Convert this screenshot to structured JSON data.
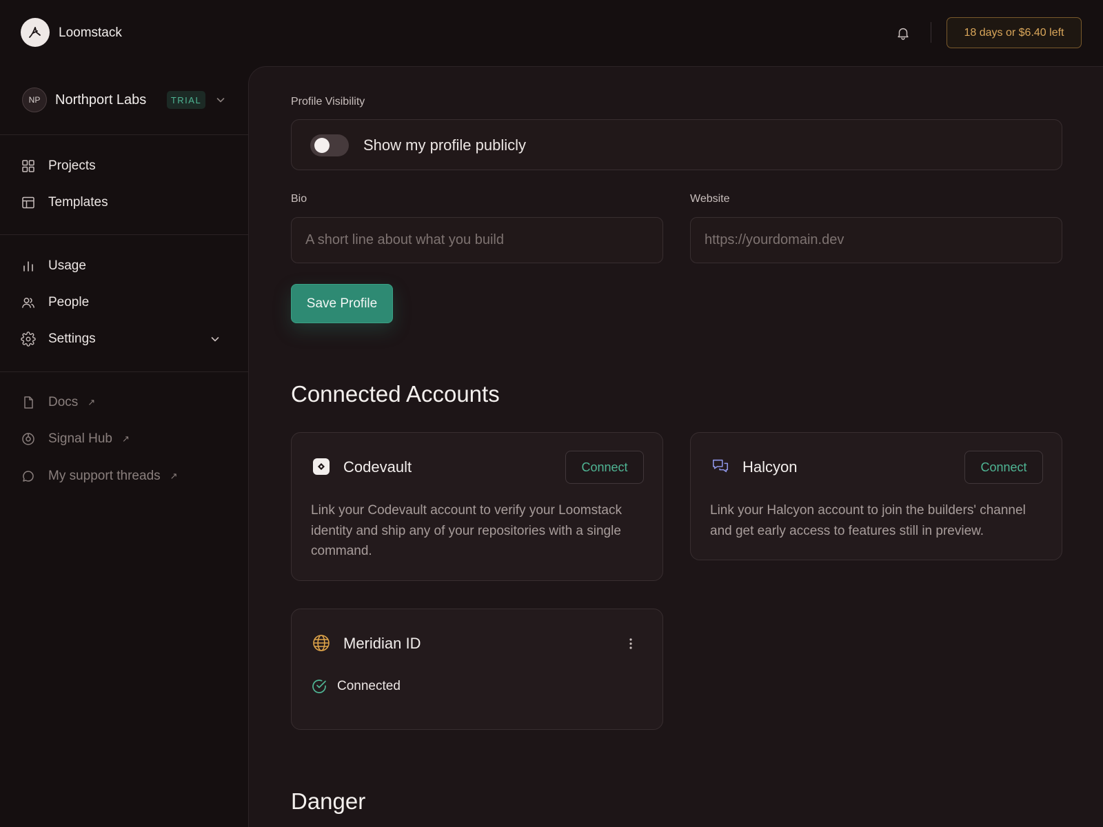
{
  "app": {
    "name": "Loomstack"
  },
  "topbar": {
    "trial_text": "18 days or $6.40 left"
  },
  "sidebar": {
    "org": {
      "initials": "NP",
      "name": "Northport Labs",
      "badge": "TRIAL"
    },
    "items": [
      {
        "label": "Projects",
        "icon": "grid-icon"
      },
      {
        "label": "Templates",
        "icon": "layout-icon"
      },
      {
        "label": "Usage",
        "icon": "bar-chart-icon"
      },
      {
        "label": "People",
        "icon": "users-icon"
      },
      {
        "label": "Settings",
        "icon": "gear-icon"
      },
      {
        "label": "Docs",
        "icon": "file-icon",
        "ext": "↗"
      },
      {
        "label": "Signal Hub",
        "icon": "signal-icon",
        "ext": "↗"
      },
      {
        "label": "My support threads",
        "icon": "chat-icon",
        "ext": "↗"
      }
    ]
  },
  "profile": {
    "visibility_label": "Profile Visibility",
    "visibility_toggle_text": "Show my profile publicly",
    "visibility_on": false,
    "bio_label": "Bio",
    "bio_placeholder": "A short line about what you build",
    "website_label": "Website",
    "website_placeholder": "https://yourdomain.dev",
    "save_label": "Save Profile"
  },
  "connected_accounts": {
    "title": "Connected Accounts",
    "cards": [
      {
        "name": "Codevault",
        "button": "Connect",
        "description": "Link your Codevault account to verify your Loomstack identity and ship any of your repositories with a single command."
      },
      {
        "name": "Halcyon",
        "button": "Connect",
        "description": "Link your Halcyon account to join the builders' channel and get early access to features still in preview."
      },
      {
        "name": "Meridian ID",
        "status": "Connected"
      }
    ]
  },
  "danger": {
    "title": "Danger"
  },
  "colors": {
    "accent": "#2e8a73",
    "trial": "#d9a65a",
    "background": "#150f10"
  }
}
